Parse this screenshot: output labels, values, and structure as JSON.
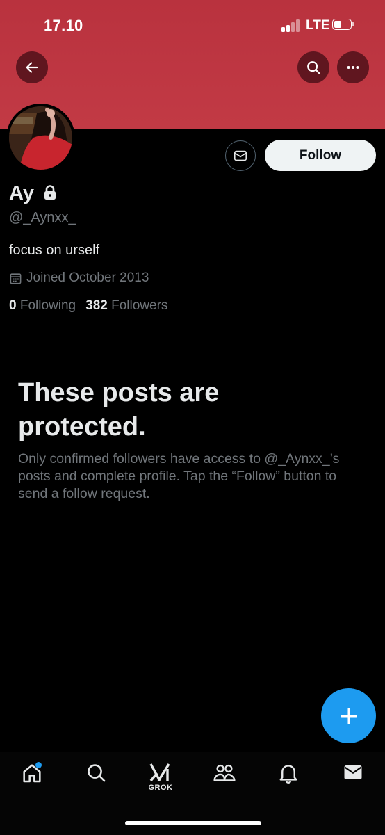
{
  "status_bar": {
    "time": "17.10",
    "network": "LTE",
    "battery_level": 0.45
  },
  "header": {
    "back_icon": "arrow-left-icon",
    "search_icon": "search-icon",
    "more_icon": "more-horizontal-icon",
    "banner_color": "#c23a45"
  },
  "profile": {
    "display_name": "Ay",
    "protected_icon": "lock-icon",
    "handle": "@_Aynxx_",
    "bio": "focus on urself",
    "joined": "Joined October 2013",
    "following_count": "0",
    "following_label": "Following",
    "followers_count": "382",
    "followers_label": "Followers"
  },
  "actions": {
    "message_icon": "mail-icon",
    "follow_label": "Follow"
  },
  "protected_notice": {
    "title": "These posts are protected.",
    "body": "Only confirmed followers have access to @_Aynxx_’s posts and complete profile. Tap the “Follow” button to send a follow request."
  },
  "fab": {
    "icon": "plus-icon",
    "color": "#1d9bf0"
  },
  "bottom_nav": {
    "items": [
      {
        "icon": "home-icon",
        "label": ""
      },
      {
        "icon": "search-icon",
        "label": ""
      },
      {
        "icon": "grok-icon",
        "label": "GROK"
      },
      {
        "icon": "communities-icon",
        "label": ""
      },
      {
        "icon": "bell-icon",
        "label": ""
      },
      {
        "icon": "mail-icon",
        "label": ""
      }
    ],
    "notification_dot_color": "#1d9bf0"
  }
}
